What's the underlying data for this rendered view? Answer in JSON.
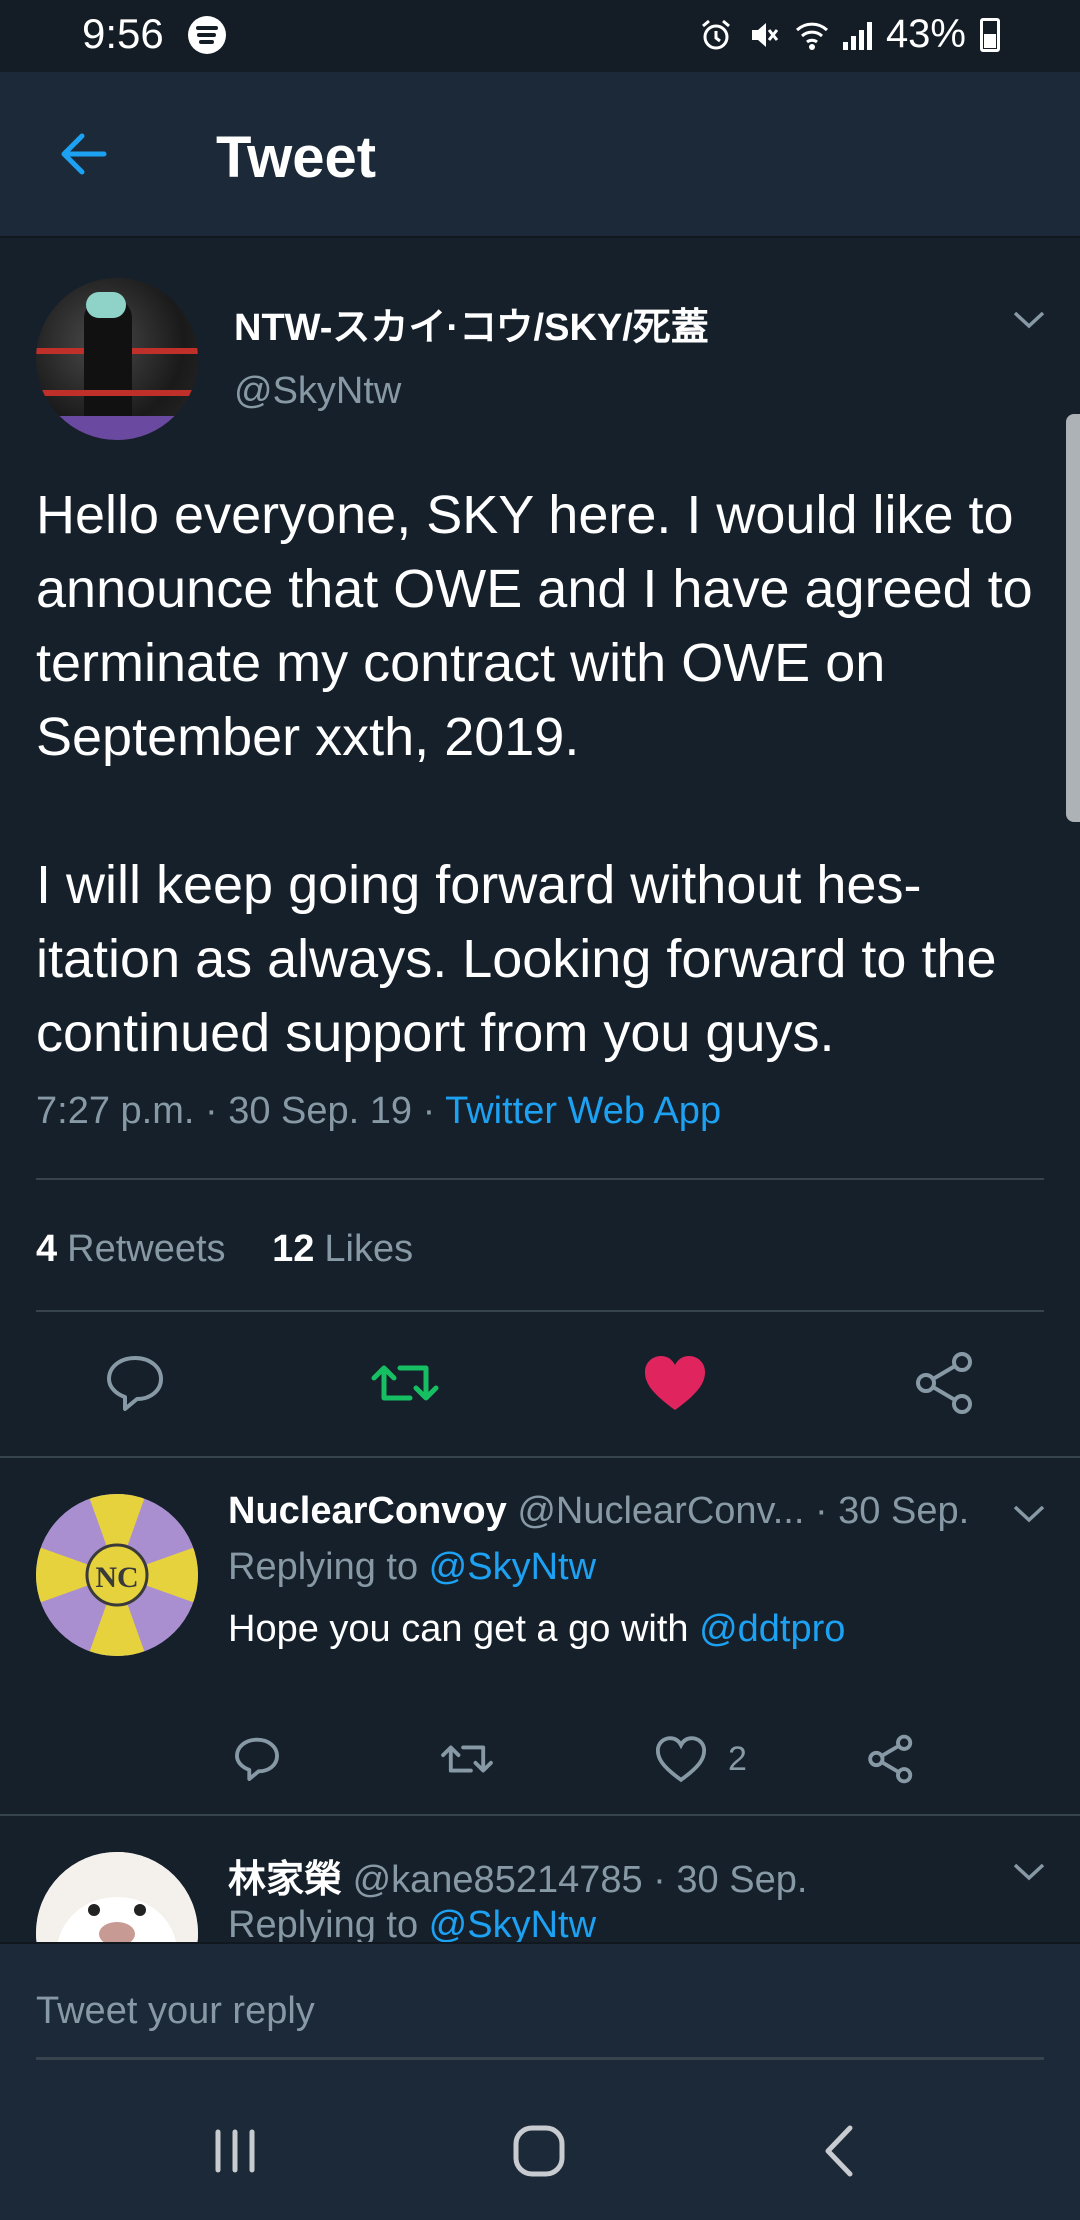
{
  "status_bar": {
    "time": "9:56",
    "battery": "43%",
    "icons": [
      "spotify-icon",
      "alarm-icon",
      "mute-icon",
      "wifi-icon",
      "signal-icon",
      "battery-icon"
    ]
  },
  "header": {
    "title": "Tweet",
    "back_icon": "back-arrow-icon"
  },
  "tweet": {
    "author_name": "NTW-スカイ·コウ/SKY/死蓋",
    "author_handle": "@SkyNtw",
    "body": "Hello everyone, SKY here. I would like to announce that OWE and I have agreed to terminate my contract with OWE on September xxth, 2019.\n\nI will keep going forward without hes-itation as always. Looking forward to the continued support from you guys.",
    "timestamp": "7:27 p.m. · 30 Sep. 19 · ",
    "source": "Twitter Web App",
    "retweets_count": "4",
    "retweets_label": "Retweets",
    "likes_count": "12",
    "likes_label": "Likes",
    "liked": true,
    "colors": {
      "link": "#1da1f2",
      "retweet": "#17bf63",
      "like": "#e0245e",
      "background": "#15202b"
    }
  },
  "replies": [
    {
      "name": "NuclearConvoy",
      "handle": "@NuclearConv...",
      "date": " · 30 Sep.",
      "replying_prefix": "Replying to ",
      "replying_to": "@SkyNtw",
      "text": "Hope you can get a go with ",
      "mention": "@ddtpro",
      "like_count": "2"
    },
    {
      "name": "林家榮",
      "handle": "@kane85214785",
      "date": " · 30 Sep.",
      "replying_prefix": "Replying to ",
      "replying_to": "@SkyNtw"
    }
  ],
  "composer": {
    "placeholder": "Tweet your reply"
  }
}
